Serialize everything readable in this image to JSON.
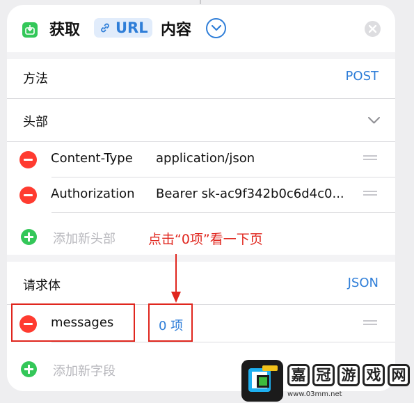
{
  "header": {
    "title_prefix": "获取",
    "chip_label": "URL",
    "title_suffix": "内容"
  },
  "method": {
    "label": "方法",
    "value": "POST"
  },
  "headers_section": {
    "label": "头部",
    "items": [
      {
        "key": "Content-Type",
        "value": "application/json"
      },
      {
        "key": "Authorization",
        "value": "Bearer sk-ac9f342b0c6d4c0..."
      }
    ],
    "add_placeholder": "添加新头部"
  },
  "annotation": {
    "text": "点击“0项”看一下页"
  },
  "body_section": {
    "label": "请求体",
    "type": "JSON",
    "items": [
      {
        "key": "messages",
        "value": "0 项"
      }
    ],
    "add_placeholder": "添加新字段"
  },
  "watermark": {
    "chars": [
      "嘉",
      "冠",
      "游",
      "戏",
      "网"
    ],
    "url": "www.03mm.net"
  },
  "colors": {
    "accent": "#2f7ed8",
    "remove": "#ff3b30",
    "add": "#34c759",
    "annotation": "#e0261e"
  }
}
